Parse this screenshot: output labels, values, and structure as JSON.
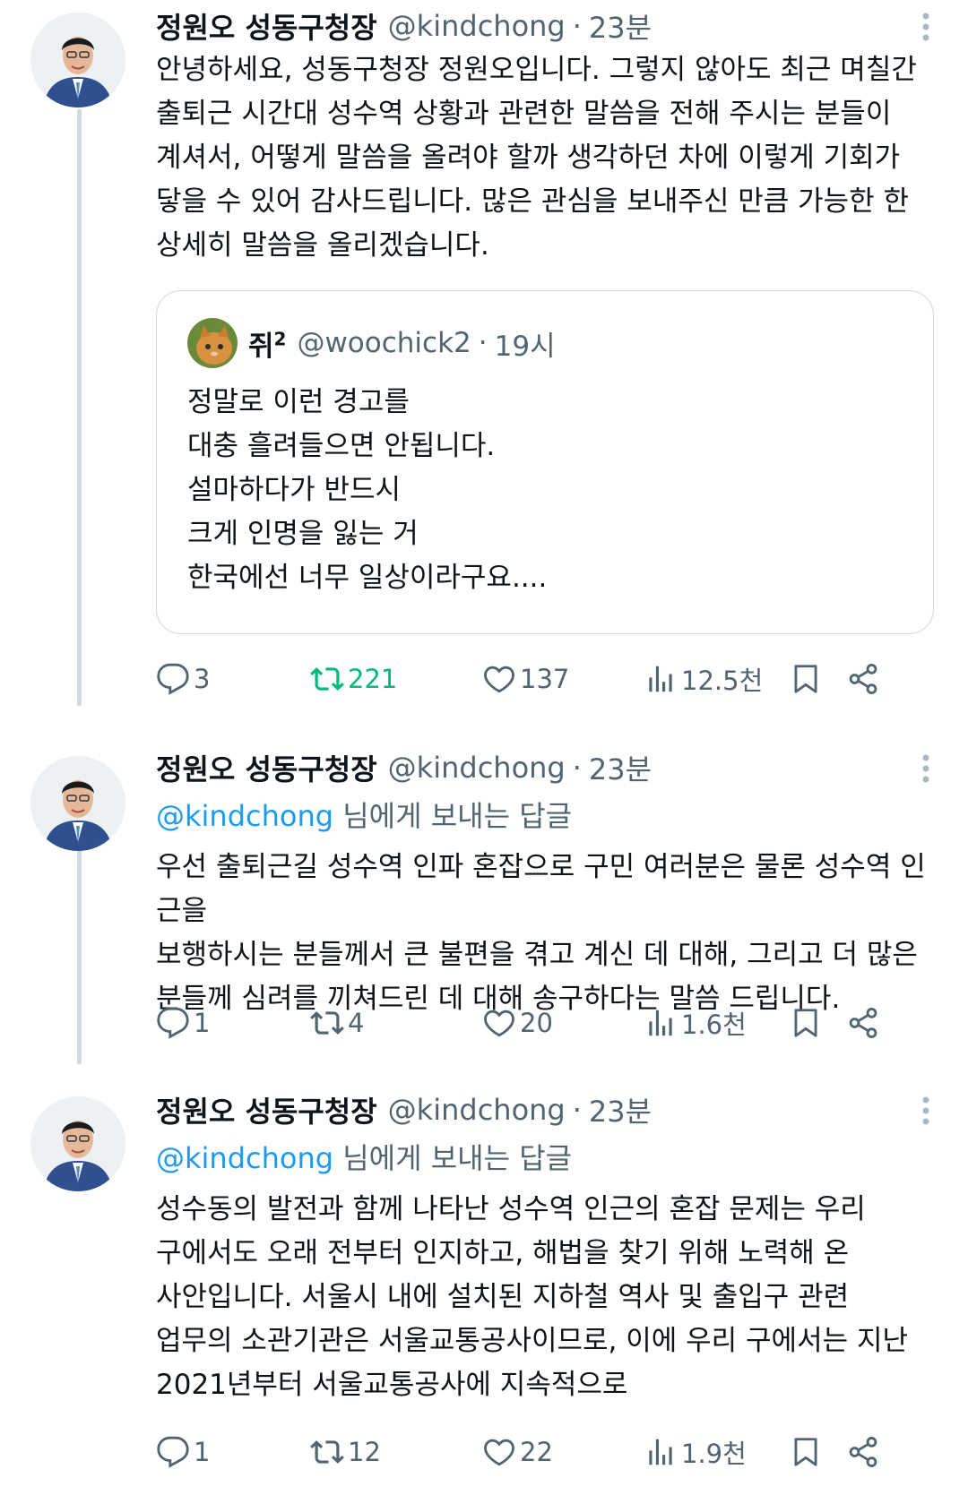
{
  "tweets": [
    {
      "author_name": "정원오 성동구청장",
      "author_handle": "@kindchong",
      "time": "23분",
      "text": "안녕하세요, 성동구청장 정원오입니다. 그렇지 않아도 최근 며칠간\n출퇴근 시간대 성수역 상황과 관련한 말씀을 전해 주시는 분들이\n계셔서, 어떻게 말씀을 올려야 할까 생각하던 차에 이렇게 기회가\n닿을 수 있어 감사드립니다. 많은 관심을 보내주신 만큼 가능한 한\n상세히 말씀을 올리겠습니다.",
      "quote": {
        "author_name": "쥐",
        "author_name_sup": "2",
        "author_handle": "@woochick2",
        "time": "19시",
        "text": "정말로 이런 경고를\n대충 흘려들으면 안됩니다.\n설마하다가 반드시\n크게 인명을 잃는 거\n한국에선 너무 일상이라구요...."
      },
      "replies": "3",
      "retweets": "221",
      "likes": "137",
      "views": "12.5천",
      "retweeted": true
    },
    {
      "author_name": "정원오 성동구청장",
      "author_handle": "@kindchong",
      "time": "23분",
      "reply_to_mention": "@kindchong",
      "reply_to_suffix": " 님에게 보내는 답글",
      "text": "우선 출퇴근길 성수역 인파 혼잡으로 구민 여러분은 물론 성수역 인근을\n보행하시는 분들께서 큰 불편을 겪고 계신 데 대해, 그리고 더 많은\n분들께 심려를 끼쳐드린 데 대해 송구하다는 말씀 드립니다.",
      "replies": "1",
      "retweets": "4",
      "likes": "20",
      "views": "1.6천",
      "retweeted": false
    },
    {
      "author_name": "정원오 성동구청장",
      "author_handle": "@kindchong",
      "time": "23분",
      "reply_to_mention": "@kindchong",
      "reply_to_suffix": " 님에게 보내는 답글",
      "text": "성수동의 발전과 함께 나타난 성수역 인근의 혼잡 문제는 우리\n구에서도 오래 전부터 인지하고, 해법을 찾기 위해 노력해 온\n사안입니다. 서울시 내에 설치된 지하철 역사 및 출입구 관련\n업무의 소관기관은 서울교통공사이므로, 이에 우리 구에서는 지난\n2021년부터 서울교통공사에 지속적으로",
      "replies": "1",
      "retweets": "12",
      "likes": "22",
      "views": "1.9천",
      "retweeted": false
    }
  ],
  "colors": {
    "text": "#0f1419",
    "secondary": "#536471",
    "link": "#1d9bf0",
    "retweet_active": "#00ba7c",
    "thread_line": "#cfd9de"
  },
  "icons": [
    "reply-icon",
    "retweet-icon",
    "like-icon",
    "views-icon",
    "bookmark-icon",
    "share-icon",
    "more-icon"
  ]
}
